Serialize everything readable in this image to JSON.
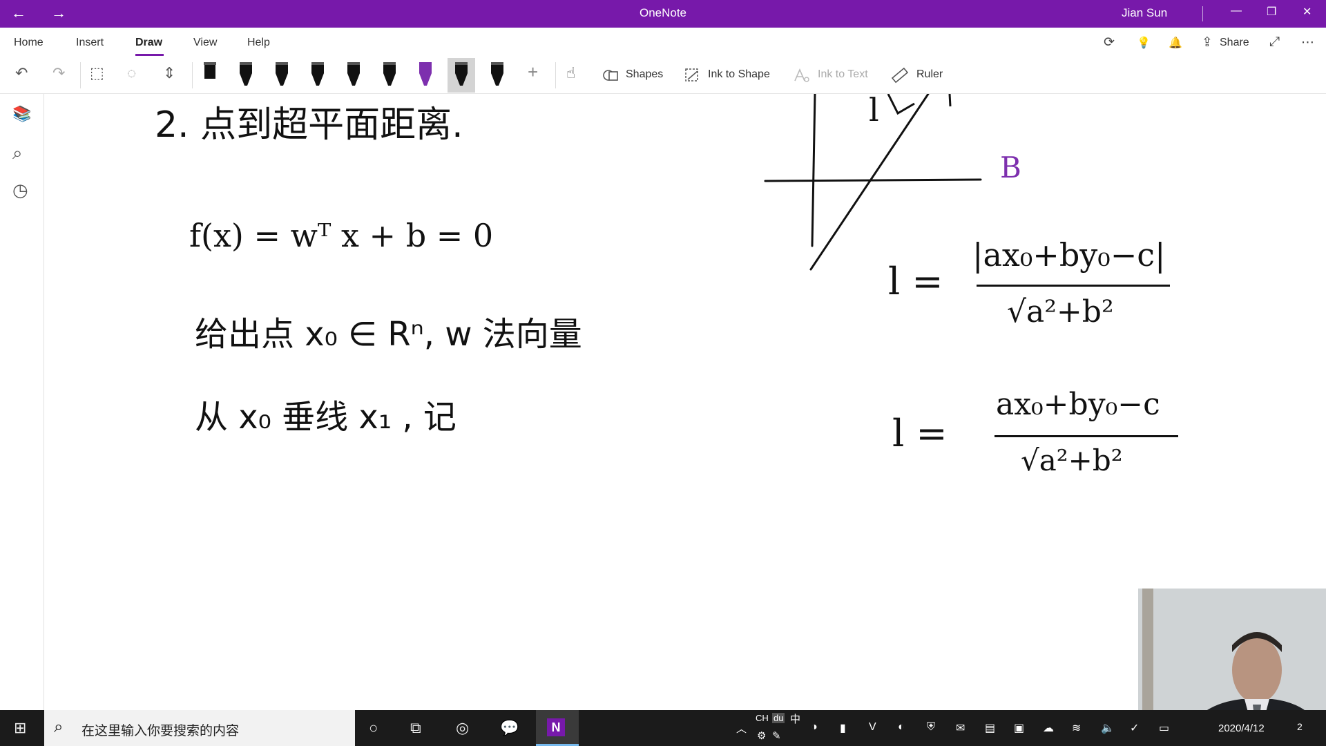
{
  "window": {
    "title": "OneNote",
    "user": "Jian Sun",
    "back_icon": "←",
    "forward_icon": "→",
    "minimize_icon": "—",
    "restore_icon": "❐",
    "close_icon": "✕",
    "accent": "#7719aa"
  },
  "ribbon": {
    "tabs": [
      "Home",
      "Insert",
      "Draw",
      "View",
      "Help"
    ],
    "active_tab": "Draw",
    "share_label": "Share",
    "sync_icon": "⟳",
    "ideas_icon": "💡",
    "bell_icon": "🔔",
    "share_icon": "⇪",
    "fullscreen_icon": "⤢",
    "more_icon": "⋯"
  },
  "toolbar": {
    "undo_icon": "↶",
    "redo_icon": "↷",
    "lasso_icon": "⬚",
    "eraser_icon": "◌",
    "space_icon": "⇕",
    "add_pen_icon": "+",
    "touch_icon": "☝",
    "shapes_label": "Shapes",
    "ink_to_shape_label": "Ink to Shape",
    "ink_to_text_label": "Ink to Text",
    "ruler_label": "Ruler",
    "pen_colors": [
      "#111111",
      "#111111",
      "#111111",
      "#111111",
      "#111111",
      "#111111",
      "#7d2fae",
      "#111111",
      "#111111"
    ],
    "selected_pen": 7
  },
  "rail": {
    "notebooks_icon": "📚",
    "search_icon": "⌕",
    "recent_icon": "◷"
  },
  "note": {
    "heading": "2.  点到超平面距离.",
    "formula": "f(x) = wᵀ x + b = 0",
    "line2": "给出点  x₀ ∈ Rⁿ,  w 法向量",
    "line3": "从  x₀  垂线  x₁ ,  记",
    "label_l": "l",
    "label_B": "B",
    "eq1_lhs": "l =",
    "eq1_num": "|ax₀+by₀−c|",
    "eq1_den": "√a²+b²",
    "eq2_lhs": "l =",
    "eq2_num": "ax₀+by₀−c",
    "eq2_den": "√a²+b²"
  },
  "taskbar": {
    "start_icon": "⊞",
    "search_placeholder": "在这里输入你要搜索的内容",
    "search_icon": "⌕",
    "cortana_icon": "○",
    "taskview_icon": "⧉",
    "app1_icon": "◎",
    "wechat_icon": "💬",
    "onenote_icon": "N",
    "tray_up_icon": "︿",
    "ime_ch": "CH",
    "ime_du": "du",
    "ime_zhong": "中",
    "date": "2020/4/12",
    "notification_count": "2"
  }
}
